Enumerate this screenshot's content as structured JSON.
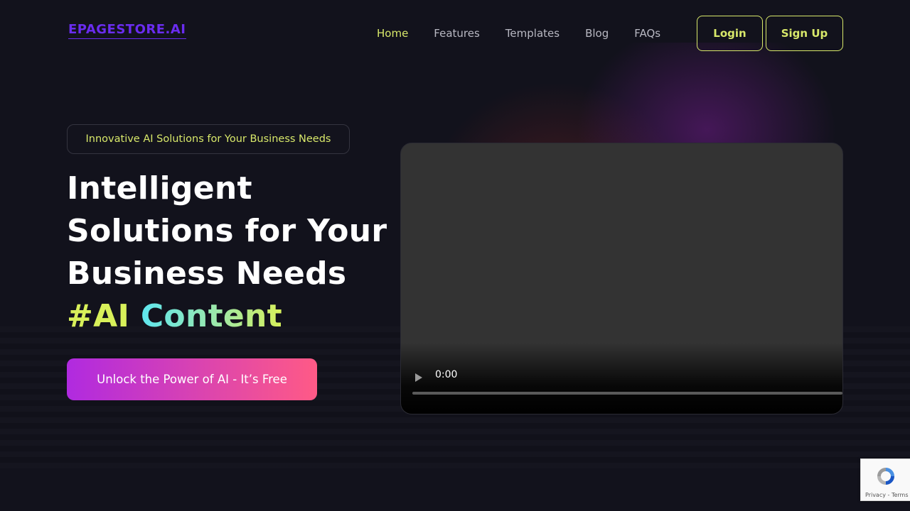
{
  "brand": {
    "logo_text": "EPAGESTORE.AI"
  },
  "nav": {
    "items": [
      {
        "label": "Home"
      },
      {
        "label": "Features"
      },
      {
        "label": "Templates"
      },
      {
        "label": "Blog"
      },
      {
        "label": "FAQs"
      }
    ],
    "active": "Home",
    "login_label": "Login",
    "signup_label": "Sign Up"
  },
  "hero": {
    "badge": "Innovative AI Solutions for Your Business Needs",
    "headline_lines": [
      "Intelligent",
      "Solutions for Your",
      "Business Needs"
    ],
    "hashtag": "#AI",
    "hashtag_word": "Content",
    "cta_label": "Unlock the Power of AI - It’s Free"
  },
  "video": {
    "time": "0:00",
    "progress": 0
  },
  "recaptcha": {
    "footer": "Privacy - Terms"
  },
  "colors": {
    "background": "#12121c",
    "accent": "#d8e86a",
    "logo": "#6a2cf0",
    "cta_start": "#b02ae0",
    "cta_end": "#ff5a86"
  }
}
